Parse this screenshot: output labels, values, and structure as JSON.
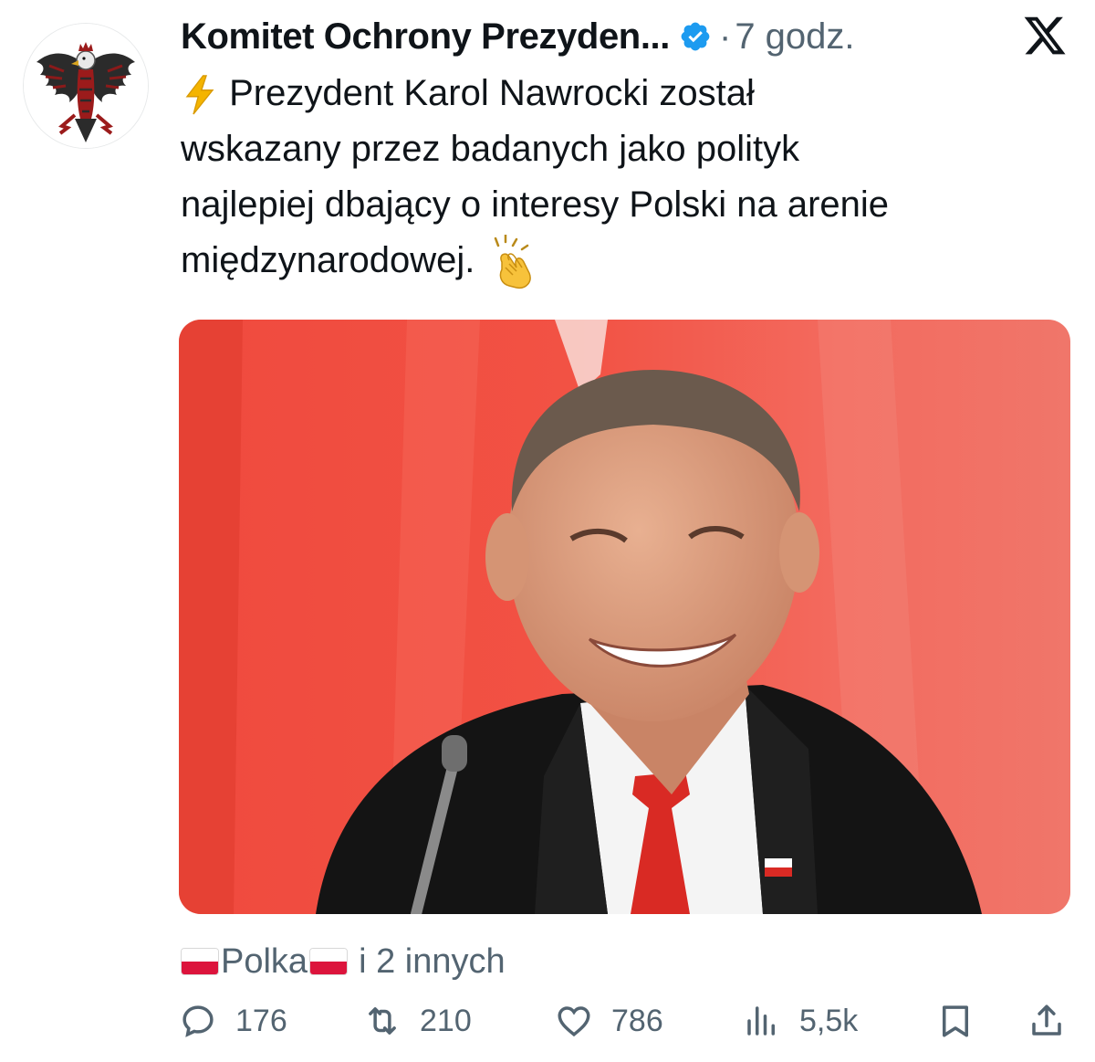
{
  "tweet": {
    "author_name": "Komitet Ochrony Prezyden...",
    "verified": true,
    "separator": "·",
    "time": "7 godz.",
    "lines": [
      "Prezydent Karol Nawrocki został",
      "wskazany przez badanych jako polityk",
      "najlepiej dbający o interesy Polski na arenie",
      "międzynarodowej."
    ],
    "leading_emoji": "high-voltage-icon",
    "trailing_emoji": "clapping-hands-icon"
  },
  "likers": {
    "first_name": "Polka",
    "rest": "i 2 innych"
  },
  "actions": {
    "replies": "176",
    "reposts": "210",
    "likes": "786",
    "views": "5,5k"
  },
  "colors": {
    "text": "#0f1419",
    "secondary": "#536471",
    "verified_blue": "#1d9bf0",
    "flag_red": "#dc143c",
    "photo_background_red": "#e8453c"
  }
}
